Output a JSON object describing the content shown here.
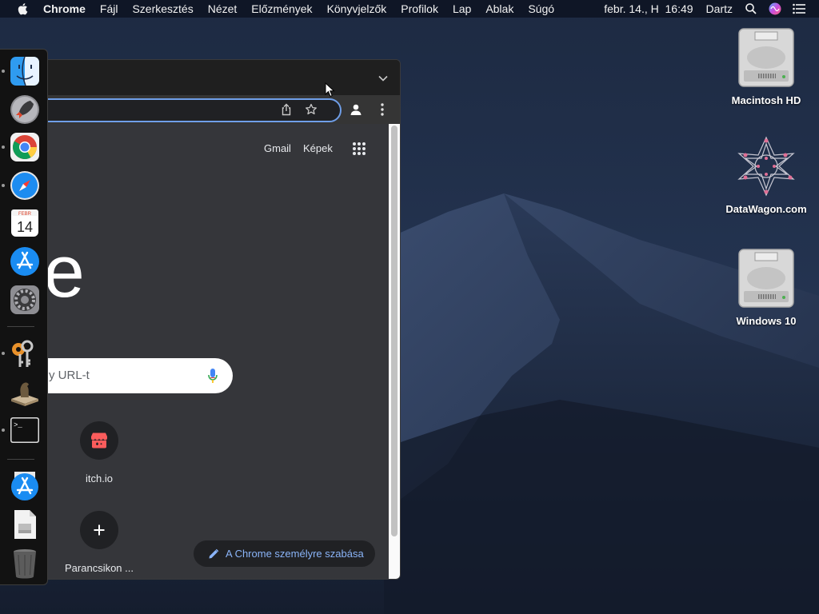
{
  "menubar": {
    "app_name": "Chrome",
    "menus": [
      "Fájl",
      "Szerkesztés",
      "Nézet",
      "Előzmények",
      "Könyvjelzők",
      "Profilok",
      "Lap",
      "Ablak",
      "Súgó"
    ],
    "clock": "febr. 14., H  16:49",
    "user": "Dartz",
    "icons": [
      "apple-icon",
      "spotlight-search-icon",
      "siri-icon",
      "control-list-icon"
    ]
  },
  "dock": {
    "items": [
      "Finder",
      "Launchpad",
      "Google Chrome",
      "Safari",
      "Naptár",
      "App Store",
      "Rendszerbeállítások",
      "Kulcskarika",
      "Chess",
      "Terminál",
      "App Store",
      "Dokumentum",
      "Kuka"
    ],
    "calendar": {
      "month": "FEBR",
      "day": "14"
    },
    "terminal_prompt": ">_"
  },
  "browser": {
    "links": {
      "gmail": "Gmail",
      "images": "Képek"
    },
    "logo_text": "gle",
    "search_placeholder": "y URL-t",
    "shortcuts": [
      {
        "label": "itch.io"
      },
      {
        "label": "Parancsikon ..."
      }
    ],
    "customize_label": "A Chrome személyre szabása"
  },
  "desktop": {
    "icons": [
      {
        "label": "Macintosh HD"
      },
      {
        "label": "DataWagon.com"
      },
      {
        "label": "Windows 10"
      }
    ]
  },
  "colors": {
    "accent": "#8ab4f8",
    "omnibox_focus": "#6f9ee8",
    "itch_red": "#fa5c5c",
    "page_bg": "#35363a"
  }
}
